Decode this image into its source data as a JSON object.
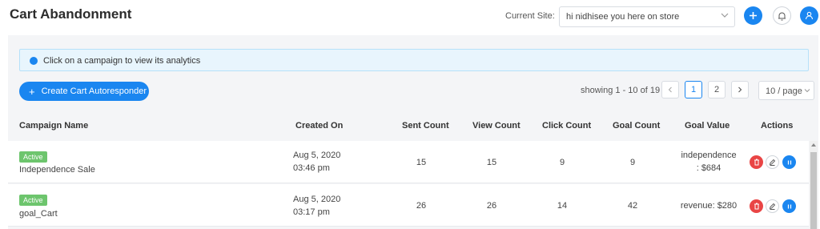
{
  "header": {
    "title": "Cart Abandonment",
    "site_label": "Current Site:",
    "site_value": "hi nidhisee you here on store"
  },
  "info": {
    "text": "Click on a campaign to view its analytics"
  },
  "toolbar": {
    "create_label": "Create Cart Autoresponder",
    "showing": "showing 1 - 10 of 19",
    "pages": [
      "1",
      "2"
    ],
    "per_page": "10 / page"
  },
  "table": {
    "columns": [
      "Campaign Name",
      "Created On",
      "Sent Count",
      "View Count",
      "Click Count",
      "Goal Count",
      "Goal Value",
      "Actions"
    ],
    "rows": [
      {
        "status": "Active",
        "name": "Independence Sale",
        "date": "Aug 5, 2020",
        "time": "03:46 pm",
        "sent": "15",
        "view": "15",
        "click": "9",
        "goal": "9",
        "value_line1": "independence",
        "value_line2": ": $684"
      },
      {
        "status": "Active",
        "name": "goal_Cart",
        "date": "Aug 5, 2020",
        "time": "03:17 pm",
        "sent": "26",
        "view": "26",
        "click": "14",
        "goal": "42",
        "value_line1": "revenue: $280",
        "value_line2": ""
      }
    ]
  },
  "colors": {
    "primary": "#1a86f0",
    "active_badge": "#6dc56d",
    "delete": "#e94545",
    "info_bg": "#e8f5fd"
  }
}
